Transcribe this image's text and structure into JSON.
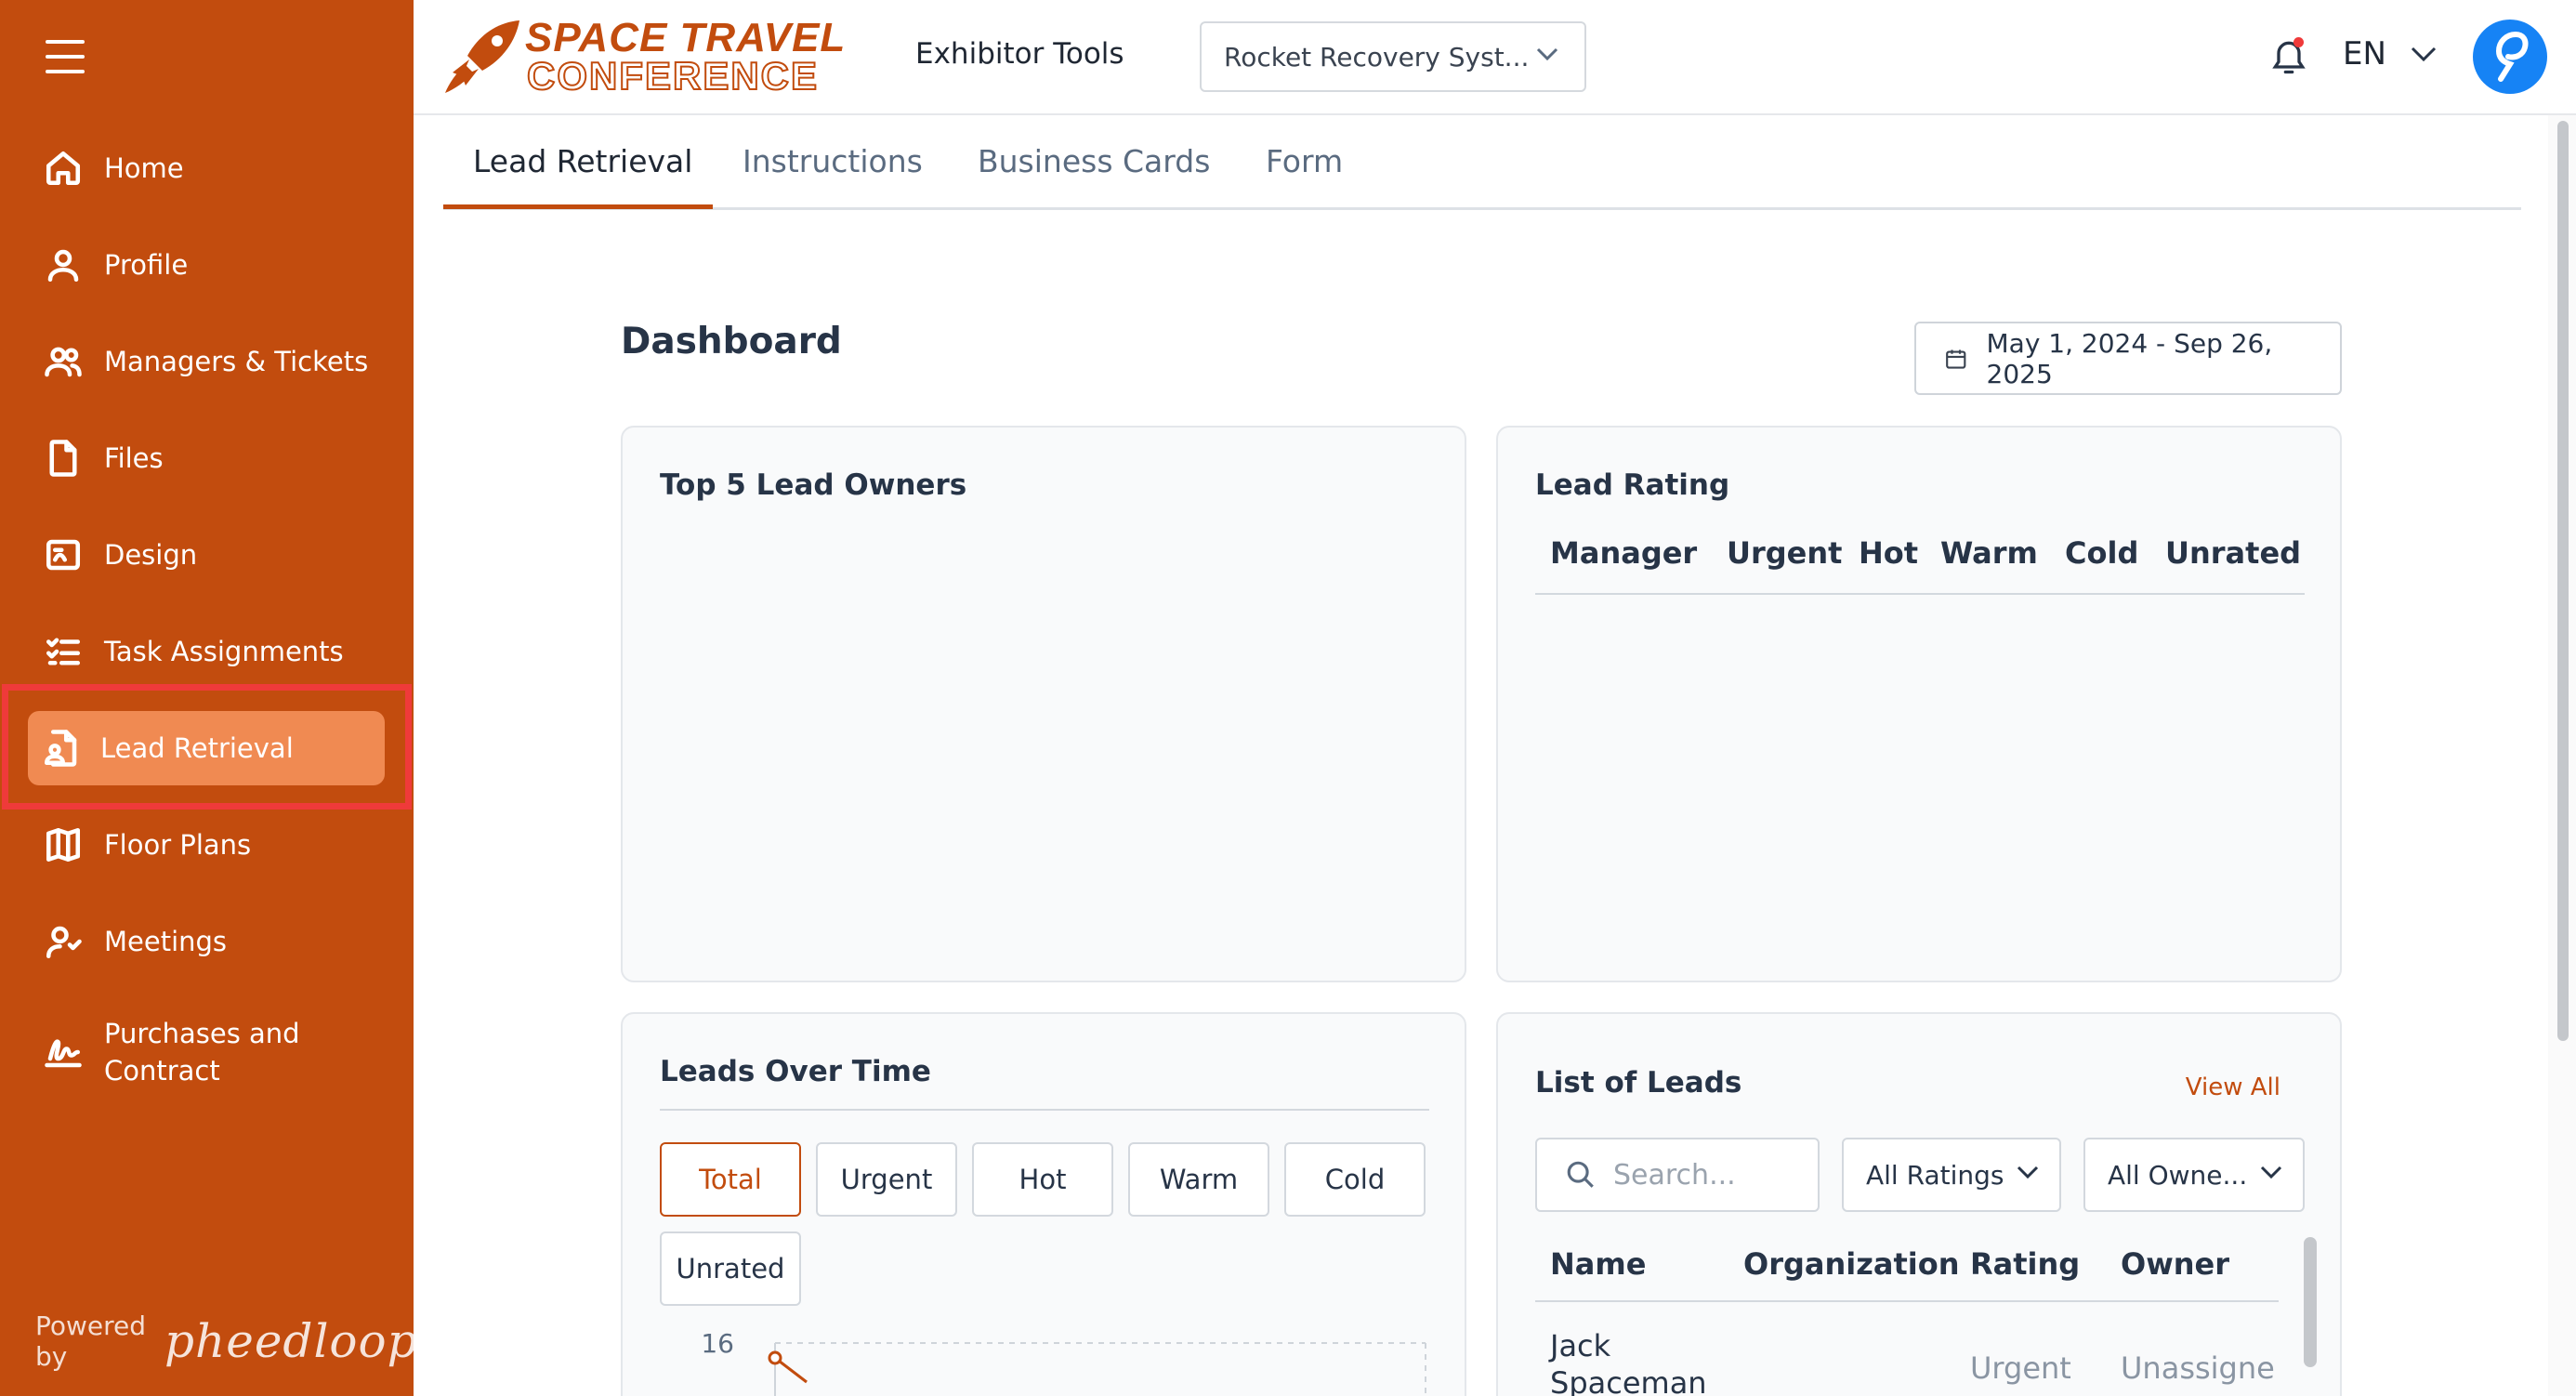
{
  "colors": {
    "brand": "#c24c0e",
    "active_nav": "#f08a52",
    "highlight": "#ef3a3a",
    "avatar": "#1683f5"
  },
  "sidebar": {
    "items": [
      {
        "label": "Home",
        "icon": "home-icon"
      },
      {
        "label": "Profile",
        "icon": "user-icon"
      },
      {
        "label": "Managers & Tickets",
        "icon": "users-icon"
      },
      {
        "label": "Files",
        "icon": "file-icon"
      },
      {
        "label": "Design",
        "icon": "design-icon"
      },
      {
        "label": "Task Assignments",
        "icon": "checklist-icon"
      },
      {
        "label": "Lead Retrieval",
        "icon": "lead-icon",
        "active": true
      },
      {
        "label": "Floor Plans",
        "icon": "map-icon"
      },
      {
        "label": "Meetings",
        "icon": "meeting-icon"
      },
      {
        "label": "Purchases and Contract",
        "icon": "signature-icon"
      }
    ],
    "powered_by": "Powered by",
    "powered_brand": "pheedloop"
  },
  "header": {
    "logo_line1": "SPACE TRAVEL",
    "logo_line2": "CONFERENCE",
    "title": "Exhibitor Tools",
    "booth_select": "Rocket Recovery Syst...",
    "language": "EN"
  },
  "tabs": [
    "Lead Retrieval",
    "Instructions",
    "Business Cards",
    "Form"
  ],
  "dashboard": {
    "title": "Dashboard",
    "date_range": "May 1, 2024 - Sep 26, 2025",
    "top_owners": {
      "title": "Top 5 Lead Owners"
    },
    "lead_rating": {
      "title": "Lead Rating",
      "columns": [
        "Manager",
        "Urgent",
        "Hot",
        "Warm",
        "Cold",
        "Unrated"
      ]
    },
    "leads_over_time": {
      "title": "Leads Over Time",
      "filters": [
        "Total",
        "Urgent",
        "Hot",
        "Warm",
        "Cold",
        "Unrated"
      ],
      "active_filter": "Total",
      "y_tick_top": "16"
    },
    "list_of_leads": {
      "title": "List of Leads",
      "view_all": "View All",
      "search_placeholder": "Search...",
      "rating_filter": "All Ratings",
      "owner_filter": "All Owne...",
      "columns": [
        "Name",
        "Organization",
        "Rating",
        "Owner"
      ],
      "rows": [
        {
          "name_line1": "Jack",
          "name_line2": "Spaceman",
          "organization": "",
          "rating": "Urgent",
          "owner": "Unassigne"
        }
      ]
    }
  }
}
